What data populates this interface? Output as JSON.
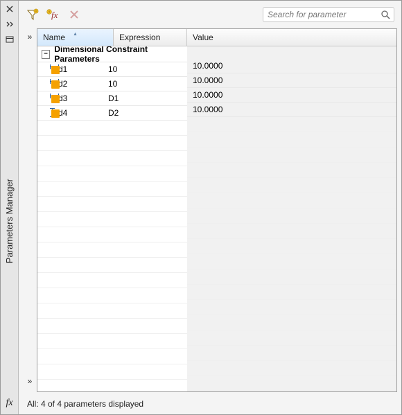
{
  "palette_title": "Parameters Manager",
  "fx_symbol": "fx",
  "toolbar": {
    "filter_tip": "Filter",
    "new_fx_tip": "New fx",
    "delete_tip": "Delete"
  },
  "search": {
    "placeholder": "Search for parameter"
  },
  "collapse": {
    "glyph": "»"
  },
  "columns": {
    "name": "Name",
    "expression": "Expression",
    "value": "Value"
  },
  "group": {
    "toggle": "−",
    "label": "Dimensional Constraint Parameters"
  },
  "rows": [
    {
      "icon": "dim-h",
      "name": "d1",
      "expression": "10",
      "value": "10.0000"
    },
    {
      "icon": "dim-h",
      "name": "d2",
      "expression": "10",
      "value": "10.0000"
    },
    {
      "icon": "dim-h",
      "name": "d3",
      "expression": "D1",
      "value": "10.0000"
    },
    {
      "icon": "dim-v",
      "name": "d4",
      "expression": "D2",
      "value": "10.0000"
    }
  ],
  "status": "All: 4 of 4 parameters displayed"
}
